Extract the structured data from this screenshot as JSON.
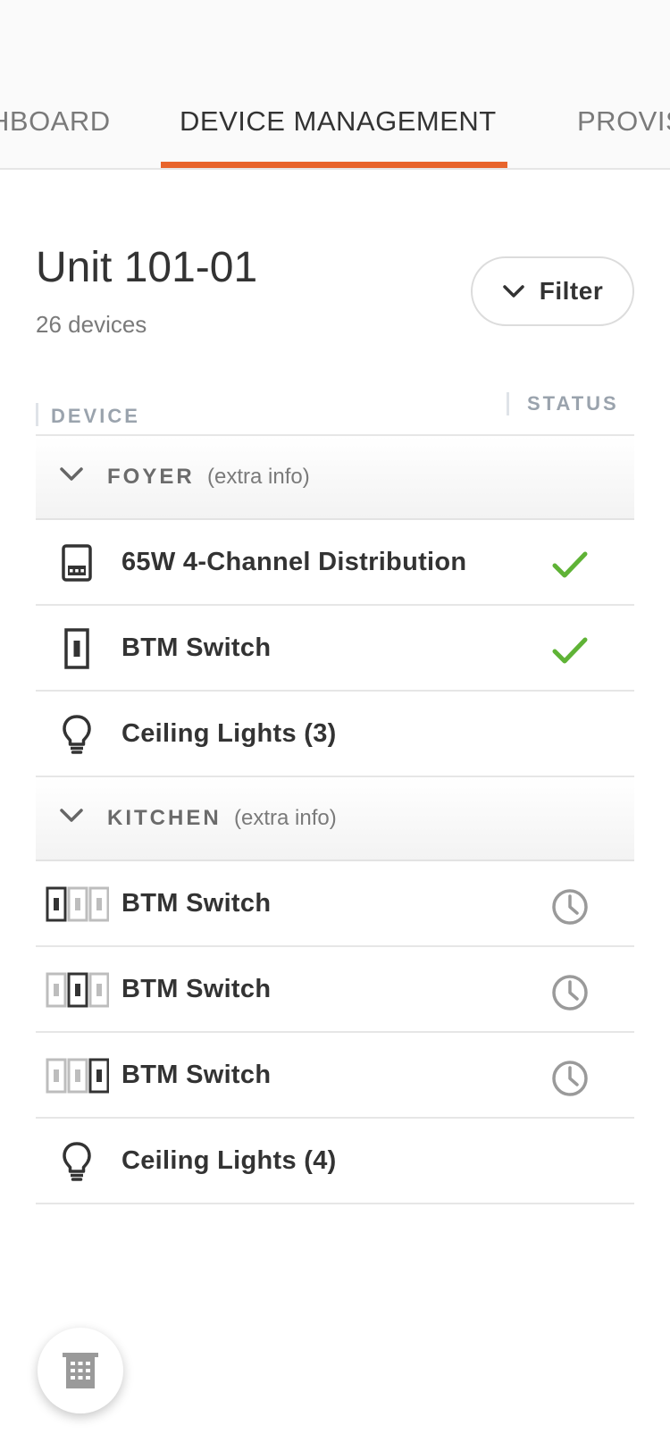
{
  "tabs": [
    "HBOARD",
    "DEVICE MANAGEMENT",
    "PROVIS"
  ],
  "unit": {
    "title": "Unit 101-01",
    "count": "26 devices"
  },
  "filter": {
    "label": "Filter"
  },
  "columns": {
    "device": "DEVICE",
    "status": "STATUS"
  },
  "groups": [
    {
      "name": "FOYER",
      "extra": "(extra info)",
      "devices": [
        {
          "name": "65W 4-Channel Distribution",
          "icon": "distribution-panel-icon",
          "status": "ok"
        },
        {
          "name": "BTM Switch",
          "icon": "switch-icon",
          "status": "ok"
        },
        {
          "name": "Ceiling Lights (3)",
          "icon": "lightbulb-icon",
          "status": ""
        }
      ]
    },
    {
      "name": "KITCHEN",
      "extra": "(extra info)",
      "devices": [
        {
          "name": "BTM Switch",
          "icon": "triple-switch-left-icon",
          "status": "pending"
        },
        {
          "name": "BTM Switch",
          "icon": "triple-switch-middle-icon",
          "status": "pending"
        },
        {
          "name": "BTM Switch",
          "icon": "triple-switch-right-icon",
          "status": "pending"
        },
        {
          "name": "Ceiling Lights (4)",
          "icon": "lightbulb-icon",
          "status": ""
        }
      ]
    }
  ],
  "fab": {
    "icon": "building-icon"
  },
  "colors": {
    "accent": "#e8652c",
    "ok": "#5fb336",
    "pending": "#9a9a9a"
  }
}
